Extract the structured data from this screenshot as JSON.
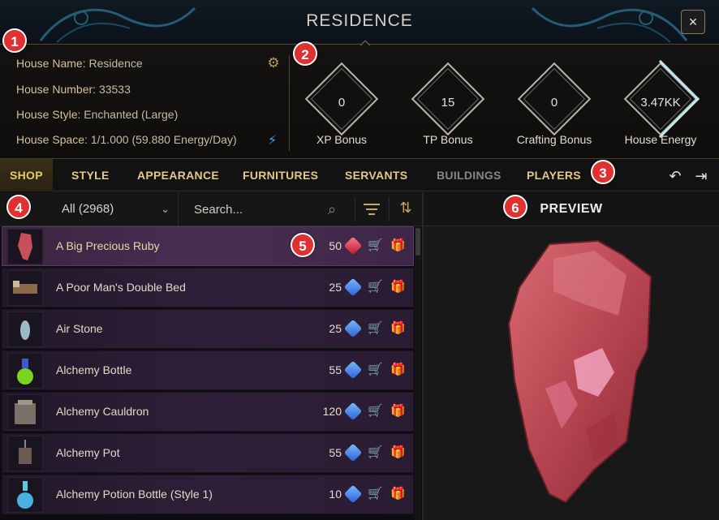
{
  "window": {
    "title": "RESIDENCE",
    "close_label": "×"
  },
  "house": {
    "name_label": "House Name:",
    "name_value": "Residence",
    "number_label": "House Number:",
    "number_value": "33533",
    "style_label": "House Style:",
    "style_value": "Enchanted (Large)",
    "space_label": "House Space:",
    "space_value": "1/1.000 (59.880 Energy/Day)"
  },
  "bonuses": [
    {
      "value": "0",
      "label": "XP Bonus"
    },
    {
      "value": "15",
      "label": "TP Bonus"
    },
    {
      "value": "0",
      "label": "Crafting Bonus"
    },
    {
      "value": "3.47KK",
      "label": "House Energy"
    }
  ],
  "tabs": [
    {
      "label": "SHOP",
      "state": "active"
    },
    {
      "label": "STYLE",
      "state": "normal"
    },
    {
      "label": "APPEARANCE",
      "state": "normal"
    },
    {
      "label": "FURNITURES",
      "state": "normal"
    },
    {
      "label": "SERVANTS",
      "state": "normal"
    },
    {
      "label": "BUILDINGS",
      "state": "disabled"
    },
    {
      "label": "PLAYERS",
      "state": "normal"
    }
  ],
  "filter": {
    "category": "All (2968)",
    "search_placeholder": "Search..."
  },
  "preview": {
    "title": "PREVIEW"
  },
  "items": [
    {
      "name": "A Big Precious Ruby",
      "price": "50",
      "currency": "red",
      "selected": true
    },
    {
      "name": "A Poor Man's Double Bed",
      "price": "25",
      "currency": "blue"
    },
    {
      "name": "Air Stone",
      "price": "25",
      "currency": "blue"
    },
    {
      "name": "Alchemy Bottle",
      "price": "55",
      "currency": "blue"
    },
    {
      "name": "Alchemy Cauldron",
      "price": "120",
      "currency": "blue"
    },
    {
      "name": "Alchemy Pot",
      "price": "55",
      "currency": "blue"
    },
    {
      "name": "Alchemy Potion Bottle (Style 1)",
      "price": "10",
      "currency": "blue"
    }
  ],
  "callouts": [
    "1",
    "2",
    "3",
    "4",
    "5",
    "6"
  ],
  "colors": {
    "accent": "#e8c86e",
    "callout": "#e03030",
    "ruby": "#c8505a"
  }
}
